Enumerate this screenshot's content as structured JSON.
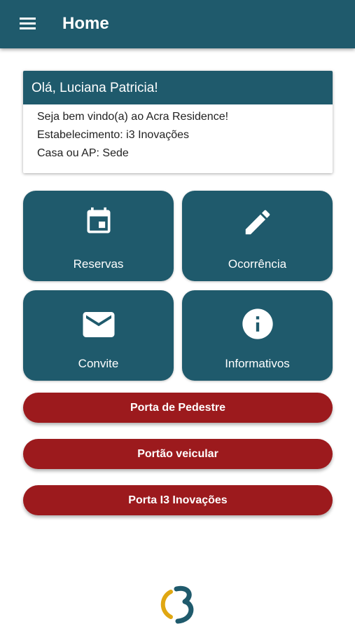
{
  "appbar": {
    "title": "Home",
    "menu_icon": "hamburger-menu-icon"
  },
  "welcome": {
    "greeting": "Olá, Luciana Patricia!",
    "lines": [
      "Seja bem vindo(a) ao Acra Residence!",
      "Estabelecimento: i3 Inovações",
      "Casa ou AP: Sede"
    ]
  },
  "tiles": [
    {
      "label": "Reservas",
      "icon": "calendar-icon"
    },
    {
      "label": "Ocorrência",
      "icon": "pencil-icon"
    },
    {
      "label": "Convite",
      "icon": "envelope-icon"
    },
    {
      "label": "Informativos",
      "icon": "info-icon"
    }
  ],
  "actions": [
    {
      "label": "Porta de Pedestre"
    },
    {
      "label": "Portão veicular"
    },
    {
      "label": "Porta I3 Inovações"
    }
  ],
  "colors": {
    "primary": "#1f5a6c",
    "danger": "#9c1a1d",
    "logo_yellow": "#e0a712"
  }
}
